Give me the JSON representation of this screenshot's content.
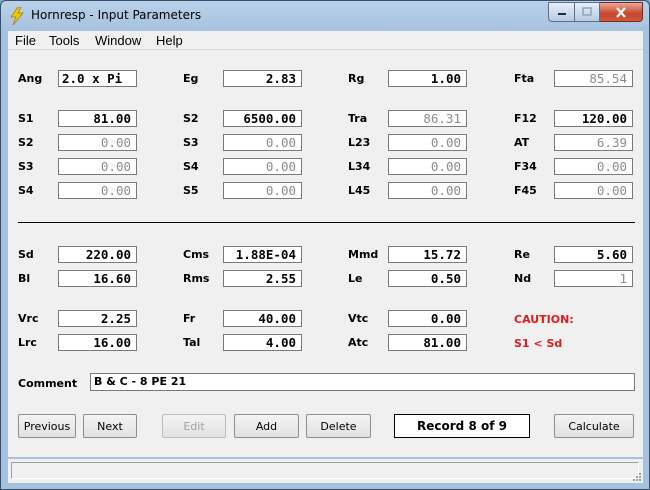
{
  "window": {
    "title": "Hornresp - Input Parameters"
  },
  "menu": [
    "File",
    "Tools",
    "Window",
    "Help"
  ],
  "top_section": {
    "rows": [
      [
        {
          "label": "Ang",
          "value": "2.0 x Pi"
        },
        {
          "label": "Eg",
          "value": "2.83"
        },
        {
          "label": "Rg",
          "value": "1.00"
        },
        {
          "label": "Fta",
          "value": "85.54"
        }
      ],
      [
        {
          "label": "S1",
          "value": "81.00"
        },
        {
          "label": "S2",
          "value": "6500.00"
        },
        {
          "label": "Tra",
          "value": "86.31"
        },
        {
          "label": "F12",
          "value": "120.00"
        }
      ],
      [
        {
          "label": "S2",
          "value": "0.00"
        },
        {
          "label": "S3",
          "value": "0.00"
        },
        {
          "label": "L23",
          "value": "0.00"
        },
        {
          "label": "AT",
          "value": "6.39"
        }
      ],
      [
        {
          "label": "S3",
          "value": "0.00"
        },
        {
          "label": "S4",
          "value": "0.00"
        },
        {
          "label": "L34",
          "value": "0.00"
        },
        {
          "label": "F34",
          "value": "0.00"
        }
      ],
      [
        {
          "label": "S4",
          "value": "0.00"
        },
        {
          "label": "S5",
          "value": "0.00"
        },
        {
          "label": "L45",
          "value": "0.00"
        },
        {
          "label": "F45",
          "value": "0.00"
        }
      ]
    ]
  },
  "driver_section": {
    "rows": [
      [
        {
          "label": "Sd",
          "value": "220.00"
        },
        {
          "label": "Cms",
          "value": "1.88E-04"
        },
        {
          "label": "Mmd",
          "value": "15.72"
        },
        {
          "label": "Re",
          "value": "5.60"
        }
      ],
      [
        {
          "label": "Bl",
          "value": "16.60"
        },
        {
          "label": "Rms",
          "value": "2.55"
        },
        {
          "label": "Le",
          "value": "0.50"
        },
        {
          "label": "Nd",
          "value": "1"
        }
      ],
      [
        {
          "label": "Vrc",
          "value": "2.25"
        },
        {
          "label": "Fr",
          "value": "40.00"
        },
        {
          "label": "Vtc",
          "value": "0.00"
        }
      ],
      [
        {
          "label": "Lrc",
          "value": "16.00"
        },
        {
          "label": "Tal",
          "value": "4.00"
        },
        {
          "label": "Atc",
          "value": "81.00"
        }
      ]
    ],
    "caution_title": "CAUTION:",
    "caution_text": "S1 < Sd"
  },
  "comment": {
    "label": "Comment",
    "value": "B & C - 8 PE 21"
  },
  "buttons": {
    "previous": "Previous",
    "next": "Next",
    "edit": "Edit",
    "add": "Add",
    "delete": "Delete",
    "calculate": "Calculate"
  },
  "record_indicator": "Record 8 of 9",
  "colors": {
    "caution": "#e01b1b",
    "readonly_text": "#8c8c8c",
    "client_bg": "#f0f0f0"
  },
  "icons": {
    "app": "lightning-bolt-icon"
  }
}
